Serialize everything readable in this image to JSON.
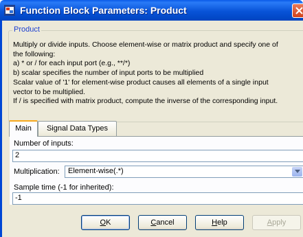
{
  "window": {
    "title": "Function Block Parameters: Product"
  },
  "group": {
    "label": "Product",
    "description": [
      "Multiply or divide inputs.  Choose element-wise or matrix product and specify one of",
      "the following:",
      "a) * or / for each input port (e.g., **/*)",
      "b) scalar specifies the number of input ports to be multiplied",
      "Scalar value of '1' for element-wise product causes all elements of a single input",
      "vector to be multiplied.",
      "If / is specified with matrix product, compute the inverse of the corresponding input."
    ]
  },
  "tabs": [
    {
      "label": "Main"
    },
    {
      "label": "Signal Data Types"
    }
  ],
  "params": {
    "num_inputs_label": "Number of inputs:",
    "num_inputs_value": "2",
    "multiplication_label": "Multiplication:",
    "multiplication_value": "Element-wise(.*)",
    "sample_time_label": "Sample time (-1 for inherited):",
    "sample_time_value": "-1"
  },
  "buttons": {
    "ok": {
      "key": "O",
      "rest": "K"
    },
    "cancel": {
      "key": "C",
      "rest": "ancel"
    },
    "help": {
      "key": "H",
      "rest": "elp"
    },
    "apply": {
      "key": "A",
      "rest": "pply"
    }
  },
  "icons": {
    "app": "simulink-block-icon",
    "close": "close-icon",
    "dropdown": "chevron-down-icon"
  },
  "colors": {
    "titlebar": "#0853d8",
    "group_label": "#1c3fd0",
    "dialog_bg": "#ece9d8",
    "panel_bg": "#fcfcfe",
    "close_button": "#d2421b"
  }
}
